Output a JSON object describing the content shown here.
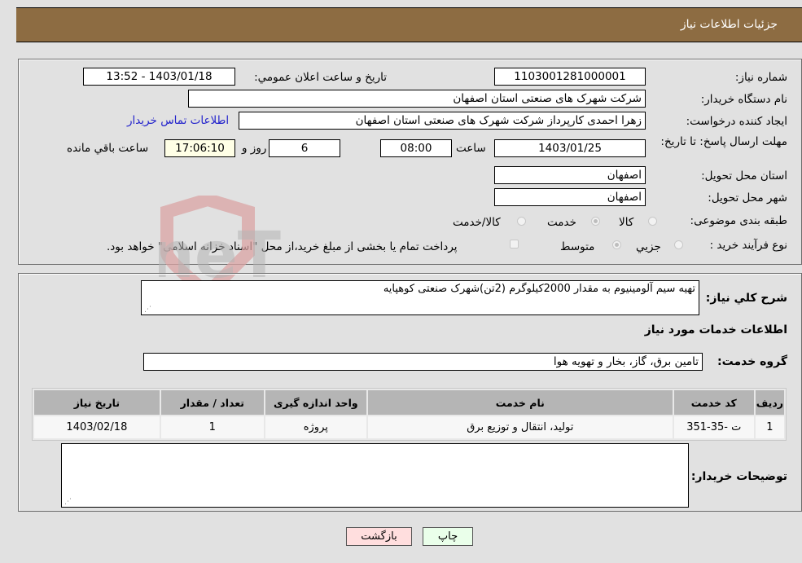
{
  "header": {
    "title": "جزئیات اطلاعات نیاز"
  },
  "details": {
    "need_number_label": "شماره نیاز:",
    "need_number": "1103001281000001",
    "announce_label": "تاریخ و ساعت اعلان عمومي:",
    "announce_value": "1403/01/18 - 13:52",
    "buyer_org_label": "نام دستگاه خریدار:",
    "buyer_org": "شرکت شهرک های صنعتی استان اصفهان",
    "creator_label": "ایجاد کننده درخواست:",
    "creator": "زهرا احمدی کارپرداز شرکت شهرک های صنعتی استان اصفهان",
    "contact_link": "اطلاعات تماس خریدار",
    "deadline_label": "مهلت ارسال پاسخ: تا تاریخ:",
    "deadline_date": "1403/01/25",
    "time_label": "ساعت",
    "deadline_time": "08:00",
    "days_value": "6",
    "days_label": "روز و",
    "remaining_time": "17:06:10",
    "remaining_label": "ساعت باقي مانده",
    "province_label": "استان محل تحویل:",
    "province": "اصفهان",
    "city_label": "شهر محل تحویل:",
    "city": "اصفهان",
    "category_label": "طبقه بندی موضوعی:",
    "category_options": [
      {
        "label": "کالا",
        "selected": false
      },
      {
        "label": "خدمت",
        "selected": true
      },
      {
        "label": "کالا/خدمت",
        "selected": false
      }
    ],
    "process_label": "نوع فرآیند خرید :",
    "process_options": [
      {
        "label": "جزيي",
        "selected": false
      },
      {
        "label": "متوسط",
        "selected": true
      }
    ],
    "treasury_checkbox_checked": false,
    "treasury_text": "پرداخت تمام یا بخشی از مبلغ خرید،از محل \"اسناد خزانه اسلامی\" خواهد بود."
  },
  "description": {
    "label": "شرح کلي نیاز:",
    "value": "تهیه سیم آلومینیوم به مقدار 2000کیلوگرم (2تن)شهرک صنعتی کوهپایه"
  },
  "services": {
    "section_title": "اطلاعات خدمات مورد نیاز",
    "group_label": "گروه خدمت:",
    "group_value": "تامین برق، گاز، بخار و تهویه هوا",
    "table": {
      "headers": [
        "ردیف",
        "کد خدمت",
        "نام خدمت",
        "واحد اندازه گیری",
        "تعداد / مقدار",
        "تاریخ نیاز"
      ],
      "rows": [
        [
          "1",
          "ت -35-351",
          "تولید، انتقال و توزیع برق",
          "پروژه",
          "1",
          "1403/02/18"
        ]
      ]
    }
  },
  "buyer_notes": {
    "label": "توضیحات خریدار:",
    "value": ""
  },
  "buttons": {
    "print": "چاپ",
    "back": "بازگشت"
  },
  "watermark": {
    "text": "AriaTender.neT"
  },
  "colors": {
    "header_bg": "#8d6c42",
    "print_bg": "#eaffea",
    "back_bg": "#ffdede",
    "link": "#2222cc"
  }
}
